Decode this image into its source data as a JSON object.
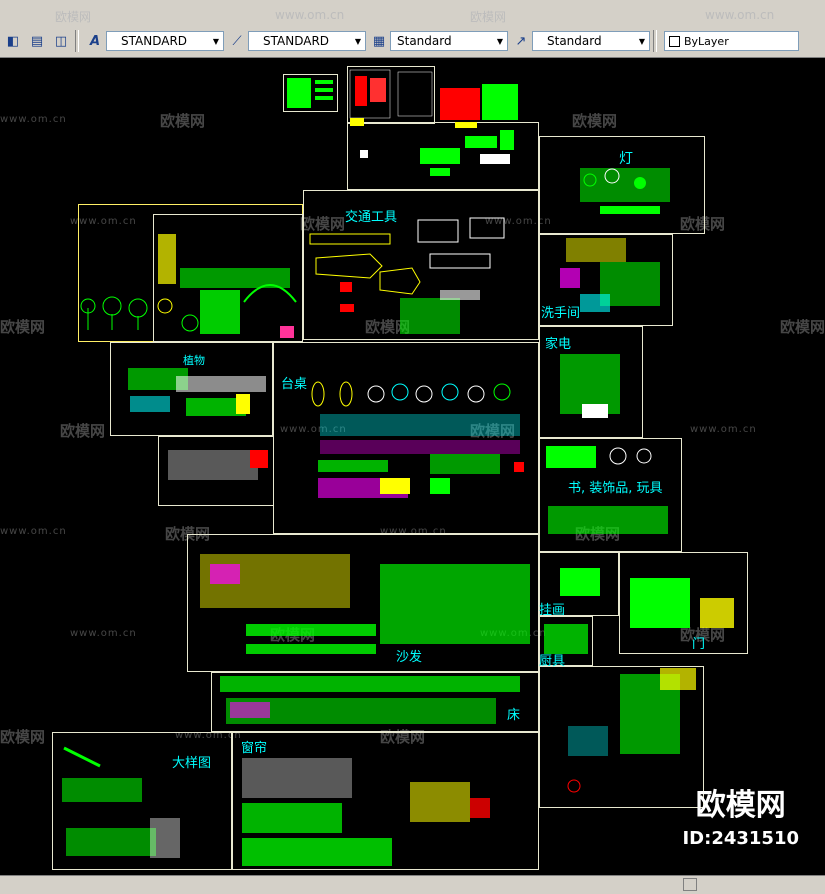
{
  "watermark_text": "欧模网",
  "watermark_url": "www.om.cn",
  "toolbar": {
    "text_style": "STANDARD",
    "dim_style": "STANDARD",
    "table_style": "Standard",
    "multileader_style": "Standard",
    "color": "ByLayer"
  },
  "labels": {
    "lamps": "灯",
    "vehicles": "交通工具",
    "bathroom": "洗手间",
    "plants": "植物",
    "appliances": "家电",
    "tables": "台桌",
    "books": "书, 装饰品, 玩具",
    "hanging": "挂画",
    "sofa": "沙发",
    "kitchen": "厨具",
    "door": "门",
    "bed": "床",
    "details": "大样图",
    "curtains": "窗帘"
  },
  "brand": {
    "name": "欧模网",
    "id": "ID:2431510"
  },
  "colors": {
    "background": "#000000",
    "toolbar": "#d4d0c8",
    "label": "#00ffff",
    "frame": "#ffffff"
  }
}
